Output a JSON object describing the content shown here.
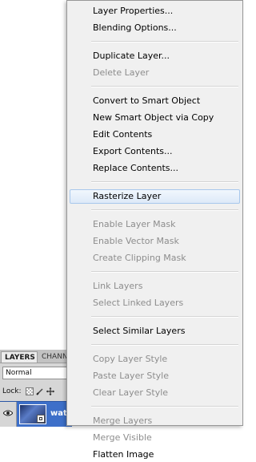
{
  "layers_panel": {
    "tabs": [
      "LAYERS",
      "CHANNELS"
    ],
    "blend_mode": "Normal",
    "lock_label": "Lock:",
    "layer_name": "wat"
  },
  "context_menu": {
    "groups": [
      [
        {
          "label": "Layer Properties...",
          "enabled": true
        },
        {
          "label": "Blending Options...",
          "enabled": true
        }
      ],
      [
        {
          "label": "Duplicate Layer...",
          "enabled": true
        },
        {
          "label": "Delete Layer",
          "enabled": false
        }
      ],
      [
        {
          "label": "Convert to Smart Object",
          "enabled": true
        },
        {
          "label": "New Smart Object via Copy",
          "enabled": true
        },
        {
          "label": "Edit Contents",
          "enabled": true
        },
        {
          "label": "Export Contents...",
          "enabled": true
        },
        {
          "label": "Replace Contents...",
          "enabled": true
        }
      ],
      [
        {
          "label": "Rasterize Layer",
          "enabled": true,
          "highlighted": true
        }
      ],
      [
        {
          "label": "Enable Layer Mask",
          "enabled": false
        },
        {
          "label": "Enable Vector Mask",
          "enabled": false
        },
        {
          "label": "Create Clipping Mask",
          "enabled": false
        }
      ],
      [
        {
          "label": "Link Layers",
          "enabled": false
        },
        {
          "label": "Select Linked Layers",
          "enabled": false
        }
      ],
      [
        {
          "label": "Select Similar Layers",
          "enabled": true
        }
      ],
      [
        {
          "label": "Copy Layer Style",
          "enabled": false
        },
        {
          "label": "Paste Layer Style",
          "enabled": false
        },
        {
          "label": "Clear Layer Style",
          "enabled": false
        }
      ],
      [
        {
          "label": "Merge Layers",
          "enabled": false
        },
        {
          "label": "Merge Visible",
          "enabled": false
        },
        {
          "label": "Flatten Image",
          "enabled": true
        }
      ]
    ]
  },
  "colors": {
    "menu_bg": "#f0f0f0",
    "disabled_text": "#8d8d8d",
    "highlight_border": "#a8c8ec",
    "selected_layer": "#3d6fc9"
  }
}
